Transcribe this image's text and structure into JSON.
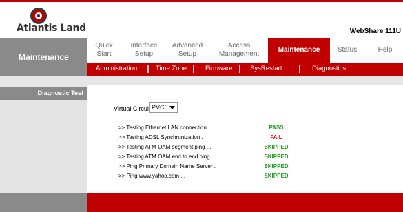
{
  "brand": {
    "logo_text": "Atlantis Land",
    "model": "WebShare 111U",
    "icon": "atlantis-logo-icon"
  },
  "section_title": "Maintenance",
  "nav": {
    "items": [
      {
        "label": "Quick Start",
        "active": false
      },
      {
        "label": "Interface Setup",
        "active": false
      },
      {
        "label": "Advanced Setup",
        "active": false
      },
      {
        "label": "Access Management",
        "active": false
      },
      {
        "label": "Maintenance",
        "active": true
      },
      {
        "label": "Status",
        "active": false
      },
      {
        "label": "Help",
        "active": false
      }
    ]
  },
  "subnav": {
    "items": [
      "Administration",
      "Time Zone",
      "Firmware",
      "SysRestart",
      "Diagnostics"
    ]
  },
  "sidebar": {
    "heading": "Diagnostic Test"
  },
  "virtual_circuit": {
    "label": "Virtual Circuit:",
    "value": "PVC0"
  },
  "tests": [
    {
      "name": ">> Testing Ethernet LAN connection ...",
      "result": "PASS"
    },
    {
      "name": ">> Testing ADSL Synchronization .",
      "result": "FAIL"
    },
    {
      "name": ">> Testing ATM OAM segment ping ...",
      "result": "SKIPPED"
    },
    {
      "name": ">> Testing ATM OAM end to end ping ...",
      "result": "SKIPPED"
    },
    {
      "name": ">> Ping Primary Domain Name Server .",
      "result": "SKIPPED"
    },
    {
      "name": ">> Ping www.yahoo.com ...",
      "result": "SKIPPED"
    }
  ],
  "colors": {
    "brand_red": "#c00000",
    "pass": "#1a9a1a",
    "fail": "#e00000",
    "skipped": "#1a9a1a"
  }
}
